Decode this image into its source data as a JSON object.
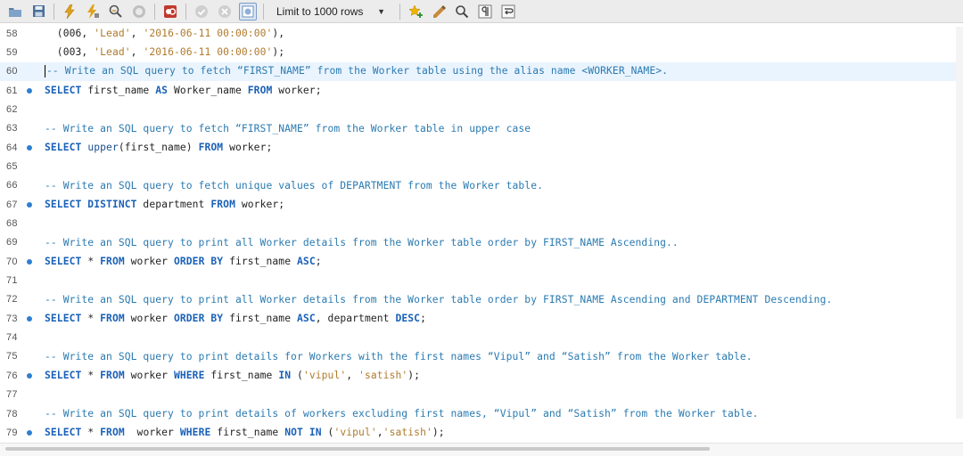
{
  "toolbar": {
    "limit_label": "Limit to 1000 rows",
    "icons": [
      "folder-icon",
      "save-icon",
      "execute-icon",
      "execute-current-icon",
      "explain-icon",
      "stop-icon",
      "toggle-continue-icon",
      "commit-icon",
      "rollback-icon",
      "autocommit-icon",
      "limit-dropdown",
      "favorite-icon",
      "beautify-icon",
      "find-icon",
      "invisible-chars-icon",
      "wrap-icon"
    ]
  },
  "colors": {
    "keyword": "#1a61b8",
    "string": "#b07a2c",
    "comment": "#2a7ab0",
    "statement_dot": "#2f7fd0",
    "current_line": "#eaf4ff"
  },
  "editor": {
    "lines": [
      {
        "num": "58",
        "tokens": [
          [
            "t",
            "  ("
          ],
          [
            "t",
            "006, "
          ],
          [
            "s",
            "'Lead'"
          ],
          [
            "t",
            ", "
          ],
          [
            "s",
            "'2016-06-11 00:00:00'"
          ],
          [
            "t",
            "),"
          ]
        ]
      },
      {
        "num": "59",
        "tokens": [
          [
            "t",
            "  ("
          ],
          [
            "t",
            "003, "
          ],
          [
            "s",
            "'Lead'"
          ],
          [
            "t",
            ", "
          ],
          [
            "s",
            "'2016-06-11 00:00:00'"
          ],
          [
            "t",
            ");"
          ]
        ]
      },
      {
        "num": "60",
        "current": true,
        "caret": true,
        "tokens": [
          [
            "c",
            "-- Write an SQL query to fetch “FIRST_NAME” from the Worker table using the alias name <WORKER_NAME>."
          ]
        ]
      },
      {
        "num": "61",
        "dot": true,
        "tokens": [
          [
            "k",
            "SELECT"
          ],
          [
            "t",
            " first_name "
          ],
          [
            "k",
            "AS"
          ],
          [
            "t",
            " Worker_name "
          ],
          [
            "k",
            "FROM"
          ],
          [
            "t",
            " worker;"
          ]
        ]
      },
      {
        "num": "62",
        "tokens": []
      },
      {
        "num": "63",
        "tokens": [
          [
            "c",
            "-- Write an SQL query to fetch “FIRST_NAME” from the Worker table in upper case"
          ]
        ]
      },
      {
        "num": "64",
        "dot": true,
        "tokens": [
          [
            "k",
            "SELECT"
          ],
          [
            "t",
            " "
          ],
          [
            "f",
            "upper"
          ],
          [
            "t",
            "(first_name) "
          ],
          [
            "k",
            "FROM"
          ],
          [
            "t",
            " worker;"
          ]
        ]
      },
      {
        "num": "65",
        "tokens": []
      },
      {
        "num": "66",
        "tokens": [
          [
            "c",
            "-- Write an SQL query to fetch unique values of DEPARTMENT from the Worker table."
          ]
        ]
      },
      {
        "num": "67",
        "dot": true,
        "tokens": [
          [
            "k",
            "SELECT DISTINCT"
          ],
          [
            "t",
            " department "
          ],
          [
            "k",
            "FROM"
          ],
          [
            "t",
            " worker;"
          ]
        ]
      },
      {
        "num": "68",
        "tokens": []
      },
      {
        "num": "69",
        "tokens": [
          [
            "c",
            "-- Write an SQL query to print all Worker details from the Worker table order by FIRST_NAME Ascending.."
          ]
        ]
      },
      {
        "num": "70",
        "dot": true,
        "tokens": [
          [
            "k",
            "SELECT"
          ],
          [
            "t",
            " * "
          ],
          [
            "k",
            "FROM"
          ],
          [
            "t",
            " worker "
          ],
          [
            "k",
            "ORDER BY"
          ],
          [
            "t",
            " first_name "
          ],
          [
            "k",
            "ASC"
          ],
          [
            "t",
            ";"
          ]
        ]
      },
      {
        "num": "71",
        "tokens": []
      },
      {
        "num": "72",
        "tokens": [
          [
            "c",
            "-- Write an SQL query to print all Worker details from the Worker table order by FIRST_NAME Ascending and DEPARTMENT Descending."
          ]
        ]
      },
      {
        "num": "73",
        "dot": true,
        "tokens": [
          [
            "k",
            "SELECT"
          ],
          [
            "t",
            " * "
          ],
          [
            "k",
            "FROM"
          ],
          [
            "t",
            " worker "
          ],
          [
            "k",
            "ORDER BY"
          ],
          [
            "t",
            " first_name "
          ],
          [
            "k",
            "ASC"
          ],
          [
            "t",
            ", department "
          ],
          [
            "k",
            "DESC"
          ],
          [
            "t",
            ";"
          ]
        ]
      },
      {
        "num": "74",
        "tokens": []
      },
      {
        "num": "75",
        "tokens": [
          [
            "c",
            "-- Write an SQL query to print details for Workers with the first names “Vipul” and “Satish” from the Worker table."
          ]
        ]
      },
      {
        "num": "76",
        "dot": true,
        "tokens": [
          [
            "k",
            "SELECT"
          ],
          [
            "t",
            " * "
          ],
          [
            "k",
            "FROM"
          ],
          [
            "t",
            " worker "
          ],
          [
            "k",
            "WHERE"
          ],
          [
            "t",
            " first_name "
          ],
          [
            "k",
            "IN"
          ],
          [
            "t",
            " ("
          ],
          [
            "s",
            "'vipul'"
          ],
          [
            "t",
            ", "
          ],
          [
            "s",
            "'satish'"
          ],
          [
            "t",
            ");"
          ]
        ]
      },
      {
        "num": "77",
        "tokens": []
      },
      {
        "num": "78",
        "tokens": [
          [
            "c",
            "-- Write an SQL query to print details of workers excluding first names, “Vipul” and “Satish” from the Worker table."
          ]
        ]
      },
      {
        "num": "79",
        "dot": true,
        "tokens": [
          [
            "k",
            "SELECT"
          ],
          [
            "t",
            " * "
          ],
          [
            "k",
            "FROM"
          ],
          [
            "t",
            "  worker "
          ],
          [
            "k",
            "WHERE"
          ],
          [
            "t",
            " first_name "
          ],
          [
            "k",
            "NOT IN"
          ],
          [
            "t",
            " ("
          ],
          [
            "s",
            "'vipul'"
          ],
          [
            "t",
            ","
          ],
          [
            "s",
            "'satish'"
          ],
          [
            "t",
            ");"
          ]
        ]
      }
    ]
  }
}
